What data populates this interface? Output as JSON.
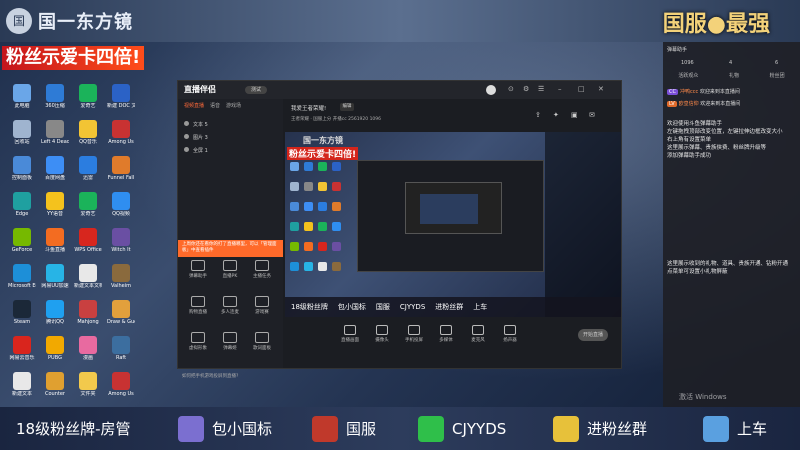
{
  "top": {
    "title": "国一东方镜",
    "right_title": "国服●最强",
    "logo": "国"
  },
  "banner": "粉丝示爱卡四倍!",
  "desktop_icons": [
    {
      "label": "此电脑",
      "color": "#6aa6e8"
    },
    {
      "label": "360压缩",
      "color": "#2e7bd6"
    },
    {
      "label": "爱奇艺",
      "color": "#1bb35a"
    },
    {
      "label": "新建 DOC 文档",
      "color": "#2b62c6"
    },
    {
      "label": "回收站",
      "color": "#9fb4cf"
    },
    {
      "label": "Left 4 Dead 2",
      "color": "#888"
    },
    {
      "label": "QQ音乐",
      "color": "#f2c434"
    },
    {
      "label": "Among Us",
      "color": "#c83232"
    },
    {
      "label": "控制面板",
      "color": "#4a8ad8"
    },
    {
      "label": "百度网盘",
      "color": "#3d8ef5"
    },
    {
      "label": "迅雷",
      "color": "#2b7de0"
    },
    {
      "label": "Funnel Fall",
      "color": "#e07b2b"
    },
    {
      "label": "Edge",
      "color": "#1fa0a0"
    },
    {
      "label": "YY语音",
      "color": "#f4c21d"
    },
    {
      "label": "爱奇艺",
      "color": "#1bb35a"
    },
    {
      "label": "QQ视频",
      "color": "#2f8ef0"
    },
    {
      "label": "GeForce",
      "color": "#76b900"
    },
    {
      "label": "斗鱼直播",
      "color": "#f36c21"
    },
    {
      "label": "WPS Office",
      "color": "#d7261e"
    },
    {
      "label": "Witch It",
      "color": "#6a4fa3"
    },
    {
      "label": "Microsoft Edge",
      "color": "#1d8fd8"
    },
    {
      "label": "网易UU加速",
      "color": "#27b4e6"
    },
    {
      "label": "新建文本文档",
      "color": "#e8e8e8"
    },
    {
      "label": "Valheim",
      "color": "#8a6a3d"
    },
    {
      "label": "Steam",
      "color": "#1b2838"
    },
    {
      "label": "腾讯QQ",
      "color": "#1fa0f0"
    },
    {
      "label": "Mahjong",
      "color": "#c94040"
    },
    {
      "label": "Draw & Guess",
      "color": "#e2a03c"
    },
    {
      "label": "网易云音乐",
      "color": "#d9251d"
    },
    {
      "label": "PUBG",
      "color": "#f2a900"
    },
    {
      "label": "漫画",
      "color": "#e86aa0"
    },
    {
      "label": "Raft",
      "color": "#3c6e9f"
    },
    {
      "label": "新建文本",
      "color": "#e8e8e8"
    },
    {
      "label": "Counter",
      "color": "#e0a030"
    },
    {
      "label": "文件夹",
      "color": "#f2c94c"
    },
    {
      "label": "Among Us",
      "color": "#c83232"
    }
  ],
  "app": {
    "logo": "直播伴侣",
    "version": "测试",
    "tabs": [
      "视频直播",
      "语音",
      "游戏场"
    ],
    "layers": [
      "文本 5",
      "图片 3",
      "全屏 1"
    ],
    "tip": "上周你还在看你的打了直播哪里，可以「管理面板」中查看插件",
    "tools": [
      {
        "label": "弹幕助手"
      },
      {
        "label": "直播PK"
      },
      {
        "label": "主播任务"
      },
      {
        "label": "购物直播"
      },
      {
        "label": "多人连麦"
      },
      {
        "label": "游戏赛"
      },
      {
        "label": "虚拟形象"
      },
      {
        "label": "弹幕姬"
      },
      {
        "label": "歌词面板"
      }
    ],
    "bottom_note": "如何把手机游戏投屏到直播?",
    "stream_title": "我爱王者荣耀!",
    "edit_label": "编辑",
    "stream_meta": "王者荣耀 · 国服上分  开播cc  2561920  1096",
    "controls": [
      {
        "label": "直播画面"
      },
      {
        "label": "摄像头"
      },
      {
        "label": "手机投屏"
      },
      {
        "label": "多媒体"
      },
      {
        "label": "麦克风"
      },
      {
        "label": "扬声器"
      }
    ],
    "start_label": "开始直播"
  },
  "preview": {
    "title": "国一东方镜",
    "banner": "粉丝示爱卡四倍!",
    "bottom_items": [
      "18级粉丝牌",
      "包小国标",
      "国服",
      "CJYYDS",
      "进粉丝群",
      "上车"
    ]
  },
  "chat": {
    "header": "弹幕助手",
    "stats": [
      "1096",
      "4",
      "6"
    ],
    "tabs": [
      "活跃观众",
      "礼物",
      "粉丝团"
    ],
    "messages": [
      {
        "badge": "CC",
        "badge_color": "#7a4fd8",
        "user": "冲鸭ccc",
        "text": "欢迎来到本直播间"
      },
      {
        "badge": "LV",
        "badge_color": "#e06a2a",
        "user": "欧皇信仰",
        "text": "欢迎来到本直播间"
      }
    ],
    "note1": "欢迎使用斗鱼弹幕助手\n左键拖拽顶部改变位置，左键拉伸边框改变大小\n右上角有设置菜单\n这里展示弹幕、贵族侠费、粉丝牌升级等\n添加弹幕助手成功",
    "note2": "这里展示收到的礼物、道具、贵族开通、钻粉开通\n点菜单可设置小礼物屏蔽"
  },
  "watermark": "激活 Windows",
  "bottombar": [
    {
      "text": "18级粉丝牌-房管",
      "icon_color": ""
    },
    {
      "text": "包小国标",
      "icon_color": "#7b6fd0"
    },
    {
      "text": "国服",
      "icon_color": "#c0392b"
    },
    {
      "text": "CJYYDS",
      "icon_color": "#2fbf4a"
    },
    {
      "text": "进粉丝群",
      "icon_color": "#e7c13a"
    },
    {
      "text": "上车",
      "icon_color": "#5aa0e0"
    }
  ]
}
